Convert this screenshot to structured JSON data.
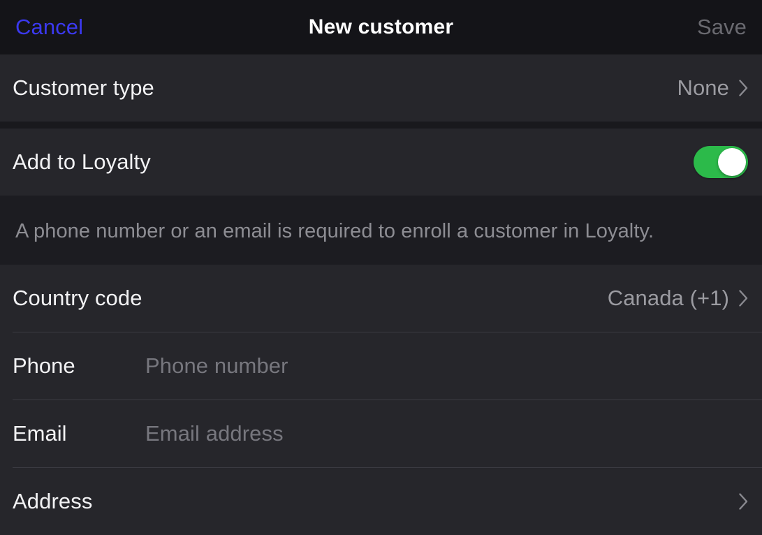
{
  "navbar": {
    "cancel_label": "Cancel",
    "title": "New customer",
    "save_label": "Save",
    "cancel_color": "#3b39f0",
    "save_color": "#6a6a70"
  },
  "sections": {
    "customer_type": {
      "label": "Customer type",
      "value": "None",
      "chevron": "chevron-right-icon"
    },
    "loyalty": {
      "label": "Add to Loyalty",
      "toggle_on": true,
      "toggle_on_color": "#2cba4a",
      "note": "A phone number or an email is required to enroll a customer in Loyalty."
    },
    "contact": {
      "country_code": {
        "label": "Country code",
        "value": "Canada (+1)",
        "chevron": "chevron-right-icon"
      },
      "phone": {
        "label": "Phone",
        "value": "",
        "placeholder": "Phone number"
      },
      "email": {
        "label": "Email",
        "value": "",
        "placeholder": "Email address"
      },
      "address": {
        "label": "Address",
        "value": "",
        "chevron": "chevron-right-icon"
      }
    }
  }
}
